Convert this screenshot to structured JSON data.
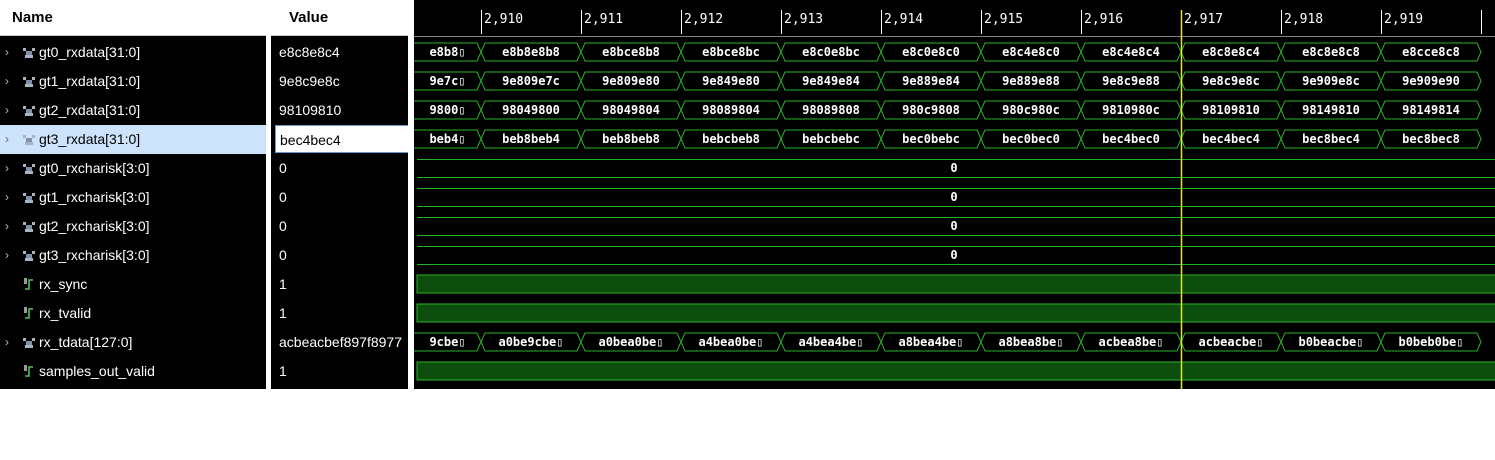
{
  "headers": {
    "name": "Name",
    "value": "Value"
  },
  "colors": {
    "wave": "#28b428",
    "bit_fill": "#0d4d0d",
    "cursor": "#e6e62a",
    "selected": "#cde3fb"
  },
  "timeline": {
    "ticks": [
      "2,910",
      "2,911",
      "2,912",
      "2,913",
      "2,914",
      "2,915",
      "2,916",
      "2,917",
      "2,918",
      "2,919"
    ]
  },
  "cursor": {
    "index": 7
  },
  "signals": [
    {
      "name": "gt0_rxdata[31:0]",
      "value": "e8c8e8c4",
      "type": "bus",
      "expandable": true,
      "segments": [
        "e8b8▯",
        "e8b8e8b8",
        "e8bce8b8",
        "e8bce8bc",
        "e8c0e8bc",
        "e8c0e8c0",
        "e8c4e8c0",
        "e8c4e8c4",
        "e8c8e8c4",
        "e8c8e8c8",
        "e8cce8c8"
      ]
    },
    {
      "name": "gt1_rxdata[31:0]",
      "value": "9e8c9e8c",
      "type": "bus",
      "expandable": true,
      "segments": [
        "9e7c▯",
        "9e809e7c",
        "9e809e80",
        "9e849e80",
        "9e849e84",
        "9e889e84",
        "9e889e88",
        "9e8c9e88",
        "9e8c9e8c",
        "9e909e8c",
        "9e909e90"
      ]
    },
    {
      "name": "gt2_rxdata[31:0]",
      "value": "98109810",
      "type": "bus",
      "expandable": true,
      "segments": [
        "9800▯",
        "98049800",
        "98049804",
        "98089804",
        "98089808",
        "980c9808",
        "980c980c",
        "9810980c",
        "98109810",
        "98149810",
        "98149814"
      ]
    },
    {
      "name": "gt3_rxdata[31:0]",
      "value": "bec4bec4",
      "type": "bus",
      "expandable": true,
      "selected": true,
      "segments": [
        "beb4▯",
        "beb8beb4",
        "beb8beb8",
        "bebcbeb8",
        "bebcbebc",
        "bec0bebc",
        "bec0bec0",
        "bec4bec0",
        "bec4bec4",
        "bec8bec4",
        "bec8bec8"
      ]
    },
    {
      "name": "gt0_rxcharisk[3:0]",
      "value": "0",
      "type": "const",
      "expandable": true,
      "label": "0"
    },
    {
      "name": "gt1_rxcharisk[3:0]",
      "value": "0",
      "type": "const",
      "expandable": true,
      "label": "0"
    },
    {
      "name": "gt2_rxcharisk[3:0]",
      "value": "0",
      "type": "const",
      "expandable": true,
      "label": "0"
    },
    {
      "name": "gt3_rxcharisk[3:0]",
      "value": "0",
      "type": "const",
      "expandable": true,
      "label": "0"
    },
    {
      "name": "rx_sync",
      "value": "1",
      "type": "bit",
      "expandable": false
    },
    {
      "name": "rx_tvalid",
      "value": "1",
      "type": "bit",
      "expandable": false
    },
    {
      "name": "rx_tdata[127:0]",
      "value": "acbeacbef897f8977",
      "type": "bus",
      "expandable": true,
      "segments": [
        "9cbe▯",
        "a0be9cbe▯",
        "a0bea0be▯",
        "a4bea0be▯",
        "a4bea4be▯",
        "a8bea4be▯",
        "a8bea8be▯",
        "acbea8be▯",
        "acbeacbe▯",
        "b0beacbe▯",
        "b0beb0be▯"
      ]
    },
    {
      "name": "samples_out_valid",
      "value": "1",
      "type": "bit",
      "expandable": false
    }
  ]
}
